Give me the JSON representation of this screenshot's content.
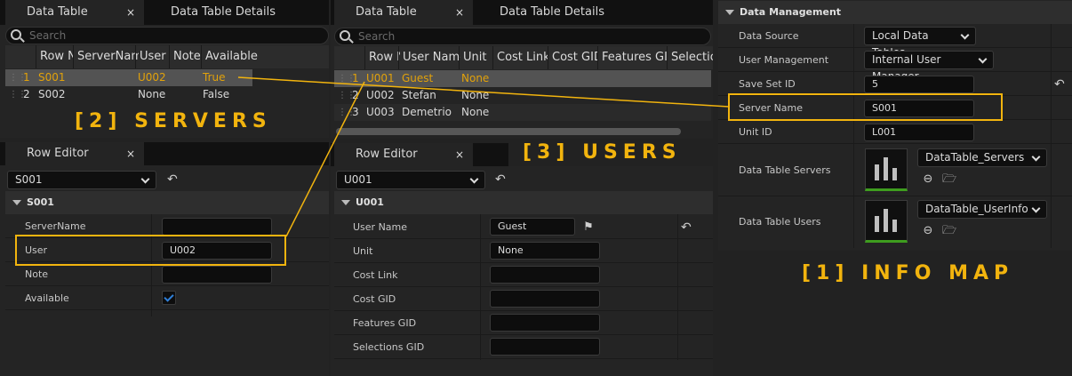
{
  "servers_panel": {
    "tabs": [
      {
        "label": "Data Table",
        "close": "×"
      },
      {
        "label": "Data Table Details"
      }
    ],
    "search_placeholder": "Search",
    "columns": [
      "Row N",
      "ServerName",
      "User",
      "Note",
      "Available"
    ],
    "rows": [
      {
        "num": "1",
        "name": "S001",
        "servername": "",
        "user": "U002",
        "note": "",
        "available": "True"
      },
      {
        "num": "2",
        "name": "S002",
        "servername": "",
        "user": "None",
        "note": "",
        "available": "False"
      }
    ],
    "title": "[2] SERVERS"
  },
  "servers_row_editor": {
    "tab_label": "Row Editor",
    "close": "×",
    "selected_row": "S001",
    "section": "S001",
    "properties": [
      {
        "label": "ServerName",
        "value": ""
      },
      {
        "label": "User",
        "value": "U002"
      },
      {
        "label": "Note",
        "value": ""
      },
      {
        "label": "Available",
        "value": "checked"
      }
    ]
  },
  "users_panel": {
    "tabs": [
      {
        "label": "Data Table",
        "close": "×"
      },
      {
        "label": "Data Table Details"
      }
    ],
    "search_placeholder": "Search",
    "columns": [
      "Row N",
      "User Name",
      "Unit",
      "Cost Link",
      "Cost GID",
      "Features GID",
      "Selectio"
    ],
    "rows": [
      {
        "num": "1",
        "name": "U001",
        "username": "Guest",
        "unit": "None"
      },
      {
        "num": "2",
        "name": "U002",
        "username": "Stefan",
        "unit": "None"
      },
      {
        "num": "3",
        "name": "U003",
        "username": "Demetrio",
        "unit": "None"
      }
    ],
    "title": "[3] USERS"
  },
  "users_row_editor": {
    "tab_label": "Row Editor",
    "close": "×",
    "selected_row": "U001",
    "section": "U001",
    "properties": [
      {
        "label": "User Name",
        "value": "Guest"
      },
      {
        "label": "Unit",
        "value": "None"
      },
      {
        "label": "Cost Link",
        "value": ""
      },
      {
        "label": "Cost GID",
        "value": ""
      },
      {
        "label": "Features GID",
        "value": ""
      },
      {
        "label": "Selections GID",
        "value": ""
      }
    ]
  },
  "info_map": {
    "section": "Data Management",
    "properties": [
      {
        "label": "Data Source",
        "value": "Local Data Tables"
      },
      {
        "label": "User Management",
        "value": "Internal User Manager"
      },
      {
        "label": "Save Set ID",
        "value": "5"
      },
      {
        "label": "Server Name",
        "value": "S001"
      },
      {
        "label": "Unit ID",
        "value": "L001"
      },
      {
        "label": "Data Table Servers",
        "value": "DataTable_Servers"
      },
      {
        "label": "Data Table Users",
        "value": "DataTable_UserInfo"
      }
    ],
    "title": "[1] INFO MAP"
  },
  "colors": {
    "highlight": "#f2b40e",
    "selected_text": "#e2a20a",
    "check": "#2f7fd8",
    "asset_bar": "#3e9d1e"
  }
}
